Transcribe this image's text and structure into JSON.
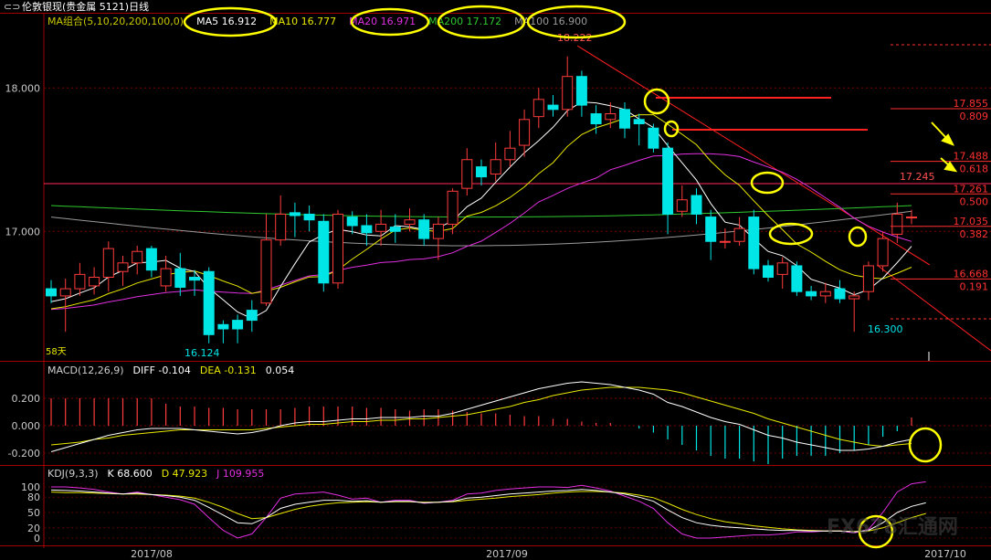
{
  "window": {
    "menu_glyph": "⊂⊃",
    "title": "伦敦银现(贵金属 5121)日线"
  },
  "colors": {
    "up": "#ff3b3b",
    "down": "#00e5e5",
    "ma5": "#ffffff",
    "ma10": "#e8e800",
    "ma20": "#e030e0",
    "ma200": "#2ec82e",
    "ma100": "#9a9a9a",
    "frame": "#a00000",
    "axis_text": "#c8c8c8",
    "highlight": "#ffff00",
    "level": "#ff3030"
  },
  "main_legend": [
    {
      "text": "MA组合(5,10,20,200,100,0)",
      "color": "#c8c800"
    },
    {
      "text": "MA5 16.912",
      "color": "#ffffff"
    },
    {
      "text": "MA10 16.777",
      "color": "#e8e800"
    },
    {
      "text": "MA20 16.971",
      "color": "#e030e0"
    },
    {
      "text": "MA200 17.172",
      "color": "#2ec82e"
    },
    {
      "text": "MA100 16.900",
      "color": "#9a9a9a"
    }
  ],
  "macd_legend": [
    {
      "text": "MACD(12,26,9)",
      "color": "#d0d0d0"
    },
    {
      "text": "DIFF  -0.104",
      "color": "#ffffff"
    },
    {
      "text": "DEA  -0.131",
      "color": "#e8e800"
    },
    {
      "text": "0.054",
      "color": "#ffffff"
    }
  ],
  "kdj_legend": [
    {
      "text": "KDJ(9,3,3)",
      "color": "#d0d0d0"
    },
    {
      "text": "K  68.600",
      "color": "#ffffff"
    },
    {
      "text": "D  47.923",
      "color": "#e8e800"
    },
    {
      "text": "J  109.955",
      "color": "#e030e0"
    }
  ],
  "annotations": {
    "high": "18.222",
    "low_left": "16.124",
    "low_right": "16.300",
    "days": "58天",
    "ref_level": "17.245",
    "watermark": "FX678汇通网"
  },
  "chart_data": [
    {
      "type": "candlestick",
      "title": "伦敦银现(贵金属 5121)日线",
      "y_ticks": [
        18.0,
        17.0
      ],
      "ylim": [
        15.84,
        18.18
      ],
      "x_ticks": [
        "2017/08",
        "2017/09",
        "2017/10"
      ],
      "candles": [
        [
          16.6,
          16.55,
          16.66,
          16.5
        ],
        [
          16.55,
          16.6,
          16.67,
          16.3
        ],
        [
          16.6,
          16.7,
          16.78,
          16.55
        ],
        [
          16.62,
          16.68,
          16.75,
          16.56
        ],
        [
          16.68,
          16.88,
          16.93,
          16.58
        ],
        [
          16.72,
          16.78,
          16.83,
          16.62
        ],
        [
          16.78,
          16.86,
          16.9,
          16.7
        ],
        [
          16.88,
          16.73,
          16.9,
          16.68
        ],
        [
          16.62,
          16.74,
          16.83,
          16.58
        ],
        [
          16.74,
          16.61,
          16.85,
          16.55
        ],
        [
          16.68,
          16.66,
          16.73,
          16.55
        ],
        [
          16.72,
          16.28,
          16.75,
          16.22
        ],
        [
          16.35,
          16.32,
          16.38,
          16.22
        ],
        [
          16.38,
          16.32,
          16.42,
          16.22
        ],
        [
          16.45,
          16.38,
          16.52,
          16.3
        ],
        [
          16.5,
          16.94,
          17.12,
          16.48
        ],
        [
          16.94,
          17.12,
          17.25,
          16.9
        ],
        [
          17.13,
          17.11,
          17.2,
          16.96
        ],
        [
          17.12,
          17.08,
          17.18,
          17.0
        ],
        [
          17.07,
          16.64,
          17.12,
          16.58
        ],
        [
          16.64,
          17.12,
          17.15,
          16.6
        ],
        [
          17.1,
          17.04,
          17.14,
          16.98
        ],
        [
          17.04,
          16.99,
          17.12,
          16.9
        ],
        [
          17.0,
          17.05,
          17.15,
          16.9
        ],
        [
          17.03,
          17.0,
          17.12,
          16.92
        ],
        [
          17.05,
          17.08,
          17.16,
          17.0
        ],
        [
          17.08,
          16.95,
          17.12,
          16.9
        ],
        [
          16.95,
          17.05,
          17.1,
          16.8
        ],
        [
          17.05,
          17.28,
          17.3,
          16.98
        ],
        [
          17.3,
          17.5,
          17.58,
          17.25
        ],
        [
          17.45,
          17.38,
          17.5,
          17.32
        ],
        [
          17.4,
          17.5,
          17.62,
          17.35
        ],
        [
          17.5,
          17.58,
          17.7,
          17.45
        ],
        [
          17.6,
          17.78,
          17.85,
          17.52
        ],
        [
          17.8,
          17.92,
          18.0,
          17.72
        ],
        [
          17.88,
          17.85,
          17.95,
          17.8
        ],
        [
          17.85,
          18.08,
          18.22,
          17.8
        ],
        [
          18.08,
          17.88,
          18.12,
          17.8
        ],
        [
          17.82,
          17.75,
          17.88,
          17.68
        ],
        [
          17.78,
          17.82,
          17.9,
          17.72
        ],
        [
          17.85,
          17.72,
          17.9,
          17.65
        ],
        [
          17.78,
          17.75,
          17.82,
          17.6
        ],
        [
          17.72,
          17.58,
          17.75,
          17.55
        ],
        [
          17.58,
          17.12,
          17.62,
          16.98
        ],
        [
          17.14,
          17.22,
          17.32,
          17.1
        ],
        [
          17.25,
          17.12,
          17.3,
          17.05
        ],
        [
          17.1,
          16.93,
          17.15,
          16.8
        ],
        [
          16.93,
          16.93,
          17.02,
          16.88
        ],
        [
          16.93,
          17.02,
          17.1,
          16.9
        ],
        [
          17.1,
          16.74,
          17.15,
          16.7
        ],
        [
          16.76,
          16.68,
          16.8,
          16.65
        ],
        [
          16.7,
          16.78,
          16.82,
          16.6
        ],
        [
          16.76,
          16.58,
          16.79,
          16.55
        ],
        [
          16.58,
          16.55,
          16.62,
          16.52
        ],
        [
          16.55,
          16.58,
          16.64,
          16.5
        ],
        [
          16.6,
          16.53,
          16.66,
          16.5
        ],
        [
          16.53,
          16.55,
          16.58,
          16.3
        ],
        [
          16.58,
          16.76,
          16.79,
          16.52
        ],
        [
          16.76,
          16.95,
          17.0,
          16.72
        ],
        [
          16.98,
          17.12,
          17.2,
          16.92
        ],
        [
          17.1,
          17.1,
          17.15,
          17.05
        ]
      ],
      "levels": [
        {
          "value": 17.855,
          "label": "17.855",
          "fib": "0.809"
        },
        {
          "value": 17.488,
          "label": "17.488",
          "fib": "0.618"
        },
        {
          "value": 17.261,
          "label": "17.261",
          "fib": "0.500"
        },
        {
          "value": 17.035,
          "label": "17.035",
          "fib": "0.382"
        },
        {
          "value": 16.668,
          "label": "16.668",
          "fib": "0.191"
        }
      ]
    },
    {
      "type": "bar+line",
      "title": "MACD(12,26,9)",
      "y_ticks": [
        0.2,
        0.0,
        -0.2
      ],
      "series": [
        {
          "name": "DIFF",
          "values": [
            -0.19,
            -0.16,
            -0.13,
            -0.1,
            -0.07,
            -0.05,
            -0.03,
            -0.02,
            -0.02,
            -0.02,
            -0.03,
            -0.04,
            -0.05,
            -0.06,
            -0.05,
            -0.03,
            0.0,
            0.02,
            0.03,
            0.03,
            0.04,
            0.05,
            0.05,
            0.06,
            0.06,
            0.06,
            0.07,
            0.07,
            0.09,
            0.12,
            0.15,
            0.18,
            0.21,
            0.24,
            0.27,
            0.29,
            0.31,
            0.32,
            0.31,
            0.3,
            0.28,
            0.26,
            0.23,
            0.17,
            0.14,
            0.1,
            0.06,
            0.03,
            0.01,
            -0.03,
            -0.07,
            -0.09,
            -0.12,
            -0.14,
            -0.16,
            -0.18,
            -0.18,
            -0.17,
            -0.15,
            -0.12,
            -0.1
          ]
        },
        {
          "name": "DEA",
          "values": [
            -0.14,
            -0.13,
            -0.12,
            -0.1,
            -0.09,
            -0.07,
            -0.06,
            -0.05,
            -0.04,
            -0.03,
            -0.03,
            -0.03,
            -0.03,
            -0.03,
            -0.03,
            -0.02,
            -0.01,
            0.0,
            0.01,
            0.01,
            0.02,
            0.03,
            0.03,
            0.04,
            0.04,
            0.05,
            0.05,
            0.06,
            0.07,
            0.08,
            0.1,
            0.12,
            0.14,
            0.17,
            0.19,
            0.22,
            0.24,
            0.26,
            0.27,
            0.28,
            0.28,
            0.28,
            0.27,
            0.26,
            0.24,
            0.21,
            0.18,
            0.15,
            0.12,
            0.09,
            0.05,
            0.02,
            -0.01,
            -0.04,
            -0.07,
            -0.1,
            -0.12,
            -0.14,
            -0.15,
            -0.14,
            -0.13
          ]
        }
      ],
      "histogram": [
        0.2,
        0.2,
        0.2,
        0.2,
        0.2,
        0.2,
        0.2,
        0.2,
        0.16,
        0.14,
        0.14,
        0.13,
        0.13,
        0.12,
        0.12,
        0.12,
        0.12,
        0.13,
        0.14,
        0.14,
        0.14,
        0.14,
        0.13,
        0.13,
        0.12,
        0.11,
        0.12,
        0.12,
        0.11,
        0.1,
        0.09,
        0.09,
        0.08,
        0.07,
        0.07,
        0.05,
        0.05,
        0.03,
        0.02,
        0.02,
        0.0,
        -0.02,
        -0.05,
        -0.1,
        -0.14,
        -0.18,
        -0.22,
        -0.24,
        -0.24,
        -0.26,
        -0.28,
        -0.24,
        -0.22,
        -0.22,
        -0.22,
        -0.2,
        -0.18,
        -0.14,
        -0.08,
        -0.04,
        0.06
      ]
    },
    {
      "type": "line",
      "title": "KDJ(9,3,3)",
      "y_ticks": [
        100,
        80,
        50,
        20,
        0
      ],
      "series": [
        {
          "name": "K",
          "values": [
            94,
            93,
            92,
            90,
            88,
            86,
            88,
            85,
            83,
            80,
            74,
            60,
            45,
            30,
            28,
            40,
            58,
            66,
            70,
            74,
            74,
            72,
            73,
            70,
            72,
            72,
            69,
            70,
            72,
            78,
            80,
            83,
            86,
            88,
            90,
            92,
            93,
            95,
            93,
            90,
            86,
            80,
            72,
            55,
            40,
            30,
            25,
            22,
            20,
            18,
            16,
            15,
            15,
            14,
            14,
            14,
            12,
            15,
            30,
            50,
            62,
            69
          ]
        },
        {
          "name": "D",
          "values": [
            90,
            89,
            89,
            88,
            87,
            86,
            86,
            85,
            84,
            82,
            78,
            70,
            60,
            48,
            38,
            40,
            48,
            56,
            62,
            66,
            69,
            70,
            71,
            70,
            71,
            71,
            70,
            70,
            71,
            74,
            76,
            78,
            81,
            83,
            85,
            88,
            90,
            91,
            91,
            90,
            88,
            84,
            79,
            68,
            56,
            46,
            38,
            32,
            28,
            24,
            21,
            18,
            16,
            15,
            14,
            14,
            13,
            14,
            20,
            30,
            40,
            48
          ]
        },
        {
          "name": "J",
          "values": [
            100,
            100,
            98,
            95,
            90,
            86,
            90,
            85,
            80,
            75,
            66,
            40,
            15,
            0,
            8,
            40,
            78,
            86,
            88,
            90,
            84,
            76,
            78,
            70,
            74,
            74,
            68,
            70,
            74,
            86,
            88,
            93,
            96,
            98,
            100,
            100,
            99,
            103,
            98,
            92,
            82,
            72,
            58,
            30,
            8,
            0,
            0,
            2,
            4,
            6,
            6,
            8,
            12,
            12,
            14,
            14,
            10,
            17,
            50,
            90,
            106,
            110
          ]
        }
      ]
    }
  ]
}
